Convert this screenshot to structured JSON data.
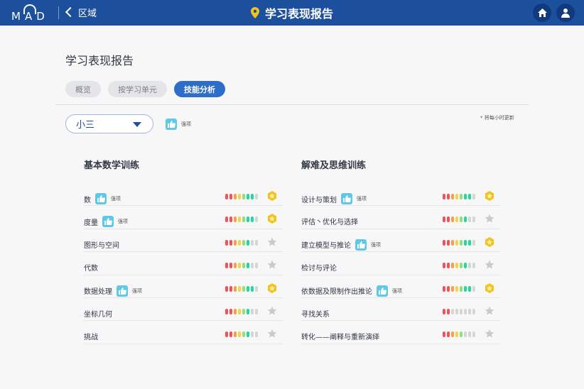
{
  "topbar": {
    "logo_text": "MAD",
    "back_label": "区域",
    "title": "学习表现报告",
    "title_icon": "location-pin-icon",
    "home_icon": "home-icon",
    "user_icon": "user-icon"
  },
  "page": {
    "heading": "学习表现报告",
    "tabs": [
      {
        "label": "概览",
        "active": false
      },
      {
        "label": "按学习单元",
        "active": false
      },
      {
        "label": "技能分析",
        "active": true
      }
    ],
    "grade_select": "小三",
    "legend_label": "强项",
    "update_note": "* 将每小时更新"
  },
  "colors": {
    "header_blue": "#1c4f9c",
    "tab_active": "#2e6ec9",
    "thumb": "#5ec9e6",
    "seg_red": "#f0525a",
    "seg_orange": "#f6a04d",
    "seg_yellow": "#f2d34b",
    "seg_lightgreen": "#8fe07e",
    "seg_teal": "#24d6a0",
    "seg_grey": "#d5d6d9",
    "star_gold": "#f4c21b",
    "star_grey": "#c9cacd"
  },
  "columns": [
    {
      "title": "基本数学训练",
      "skills": [
        {
          "name": "数",
          "strength": true,
          "strength_label": "强项",
          "level": 7,
          "gold": true
        },
        {
          "name": "度量",
          "strength": true,
          "strength_label": "强项",
          "level": 7,
          "gold": true
        },
        {
          "name": "图形与空间",
          "strength": false,
          "strength_label": "",
          "level": 6,
          "gold": false
        },
        {
          "name": "代数",
          "strength": false,
          "strength_label": "",
          "level": 6,
          "gold": false
        },
        {
          "name": "数据处理",
          "strength": true,
          "strength_label": "强项",
          "level": 7,
          "gold": true
        },
        {
          "name": "坐标几何",
          "strength": false,
          "strength_label": "",
          "level": 6,
          "gold": false
        },
        {
          "name": "挑战",
          "strength": false,
          "strength_label": "",
          "level": 6,
          "gold": false
        }
      ]
    },
    {
      "title": "解难及思维训练",
      "skills": [
        {
          "name": "设计与策划",
          "strength": true,
          "strength_label": "强项",
          "level": 7,
          "gold": true
        },
        {
          "name": "评估丶优化与选择",
          "strength": false,
          "strength_label": "",
          "level": 6,
          "gold": false
        },
        {
          "name": "建立模型与推论",
          "strength": true,
          "strength_label": "强项",
          "level": 7,
          "gold": true
        },
        {
          "name": "检讨与评论",
          "strength": false,
          "strength_label": "",
          "level": 6,
          "gold": false
        },
        {
          "name": "依数据及限制作出推论",
          "strength": true,
          "strength_label": "强项",
          "level": 7,
          "gold": true
        },
        {
          "name": "寻找关系",
          "strength": false,
          "strength_label": "",
          "level": 2,
          "gold": false
        },
        {
          "name": "转化——阐释与重新演绎",
          "strength": false,
          "strength_label": "",
          "level": 5,
          "gold": false
        }
      ]
    }
  ]
}
